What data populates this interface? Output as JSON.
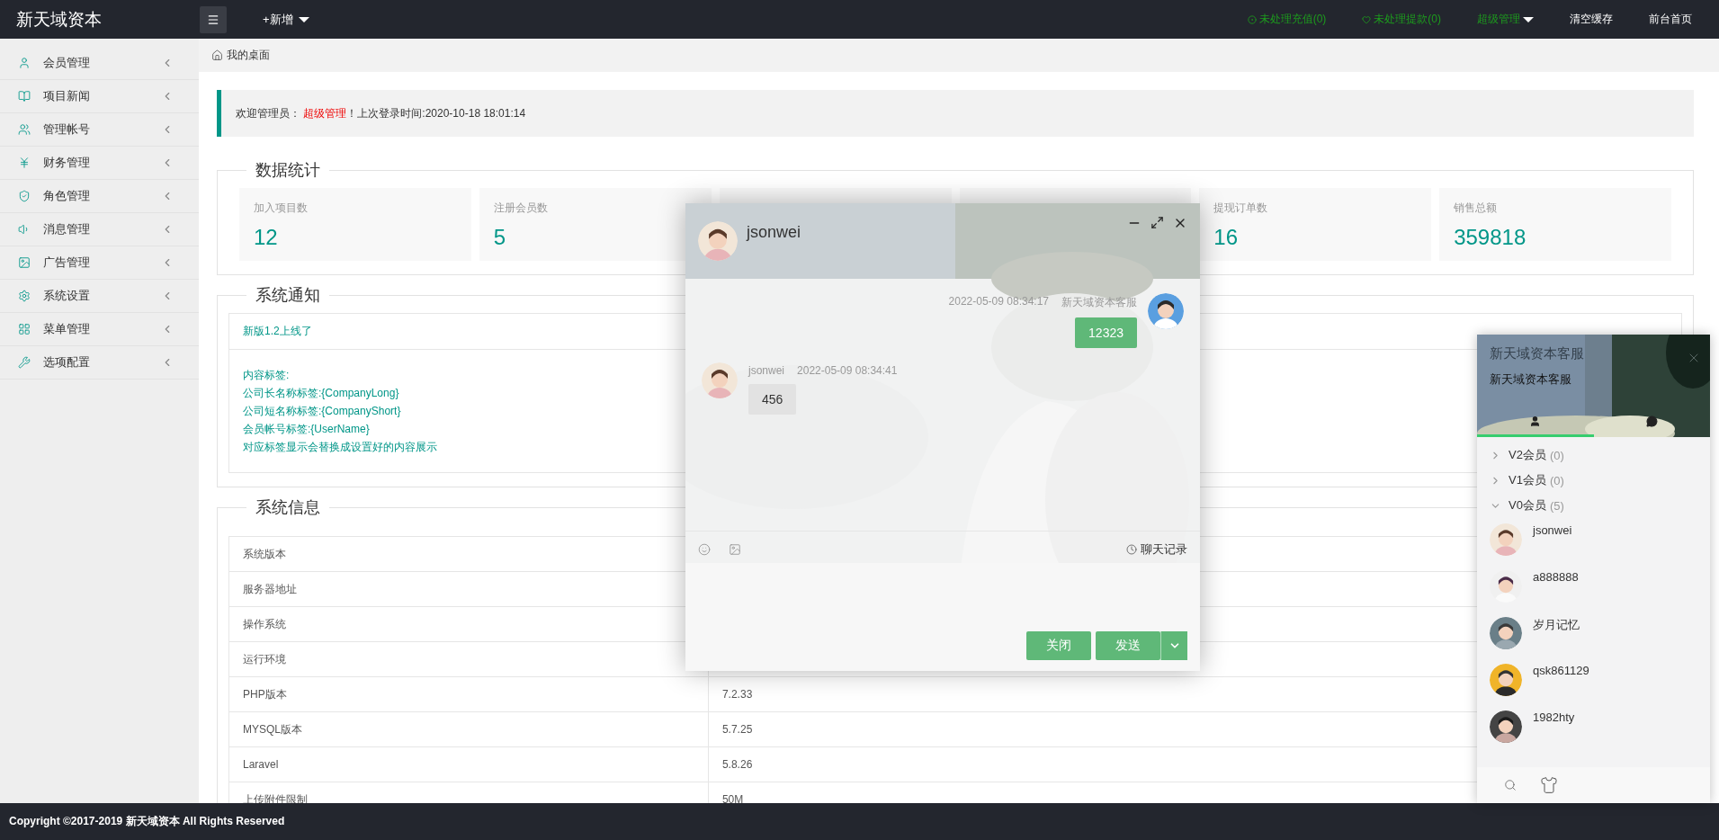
{
  "app": {
    "logo": "新天域资本",
    "add_menu": "+新增"
  },
  "top_links": [
    {
      "text": "未处理充值(0)",
      "kind": "recharge"
    },
    {
      "text": "未处理提款(0)",
      "kind": "withdraw"
    },
    {
      "text": "超级管理",
      "kind": "dropdown"
    },
    {
      "text": "清空缓存",
      "kind": "plain"
    },
    {
      "text": "前台首页",
      "kind": "plain"
    }
  ],
  "sidebar": {
    "items": [
      {
        "label": "会员管理"
      },
      {
        "label": "项目新闻"
      },
      {
        "label": "管理帐号"
      },
      {
        "label": "财务管理"
      },
      {
        "label": "角色管理"
      },
      {
        "label": "消息管理"
      },
      {
        "label": "广告管理"
      },
      {
        "label": "系统设置"
      },
      {
        "label": "菜单管理"
      },
      {
        "label": "选项配置"
      }
    ]
  },
  "breadcrumb": "我的桌面",
  "welcome": {
    "prefix": "欢迎管理员：",
    "name": "超级管理",
    "suffix": "！上次登录时间:2020-10-18 18:01:14"
  },
  "stats": {
    "title": "数据统计",
    "cards": [
      {
        "label": "加入项目数",
        "value": "12"
      },
      {
        "label": "注册会员数",
        "value": "5"
      },
      {
        "label": "提现订单数",
        "value": "16"
      },
      {
        "label": "销售总额",
        "value": "359818"
      }
    ]
  },
  "notice": {
    "title": "系统通知",
    "heading": "新版1.2上线了",
    "lines": [
      "内容标签:",
      "公司长名称标签:{CompanyLong}",
      "公司短名称标签:{CompanyShort}",
      "会员帐号标签:{UserName}",
      "对应标签显示会替换成设置好的内容展示"
    ]
  },
  "system_info": {
    "title": "系统信息",
    "rows": [
      {
        "label": "系统版本"
      },
      {
        "label": "服务器地址"
      },
      {
        "label": "操作系统"
      },
      {
        "label": "运行环境"
      },
      {
        "label": "PHP版本",
        "value": "7.2.33"
      },
      {
        "label": "MYSQL版本",
        "value": "5.7.25"
      },
      {
        "label": "Laravel",
        "value": "5.8.26"
      },
      {
        "label": "上传附件限制",
        "value": "50M"
      }
    ]
  },
  "footer": "Copyright ©2017-2019 新天域资本 All Rights Reserved",
  "chat": {
    "title": "jsonwei",
    "messages": [
      {
        "kind": "sent",
        "time": "2022-05-09 08:34:17",
        "sender": "新天域资本客服",
        "text": "12323"
      },
      {
        "kind": "received",
        "sender": "jsonwei",
        "time": "2022-05-09 08:34:41",
        "text": "456"
      }
    ],
    "history": "聊天记录",
    "buttons": [
      {
        "label": "关闭",
        "kind": "close"
      },
      {
        "label": "发送",
        "kind": "send"
      }
    ]
  },
  "service_panel": {
    "title": "新天域资本客服",
    "subtitle": "新天域资本客服",
    "tabs": [
      {
        "selected": true
      },
      {
        "selected": false
      }
    ],
    "groups": [
      {
        "name": "V2会员",
        "count": "(0)",
        "expanded": false
      },
      {
        "name": "V1会员",
        "count": "(0)",
        "expanded": false
      },
      {
        "name": "V0会员",
        "count": "(5)",
        "expanded": true,
        "children": [
          {
            "name": "jsonwei"
          },
          {
            "name": "a888888"
          },
          {
            "name": "岁月记忆"
          },
          {
            "name": "qsk861129"
          },
          {
            "name": "1982hty"
          }
        ]
      }
    ]
  }
}
